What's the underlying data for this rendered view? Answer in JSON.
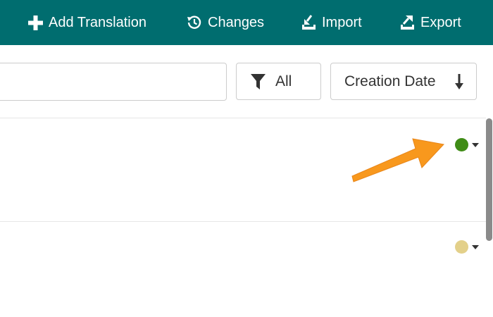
{
  "colors": {
    "brand": "#006d6f",
    "status_green": "#3f8c16",
    "status_yellow": "#e3d08a",
    "annotation_orange": "#f8981d"
  },
  "toolbar": {
    "add_label": "Add Translation",
    "add_icon": "plus-icon",
    "changes_label": "Changes",
    "changes_icon": "history-icon",
    "import_label": "Import",
    "import_icon": "import-icon",
    "export_label": "Export",
    "export_icon": "export-icon"
  },
  "search": {
    "value": "",
    "placeholder": ""
  },
  "filter": {
    "label": "All",
    "icon": "filter-icon"
  },
  "sort": {
    "label": "Creation Date",
    "icon": "arrow-down-icon"
  },
  "rows": [
    {
      "status_color": "#3f8c16",
      "icon": "caret-down-icon"
    },
    {
      "status_color": "#e3d08a",
      "icon": "caret-down-icon"
    }
  ]
}
